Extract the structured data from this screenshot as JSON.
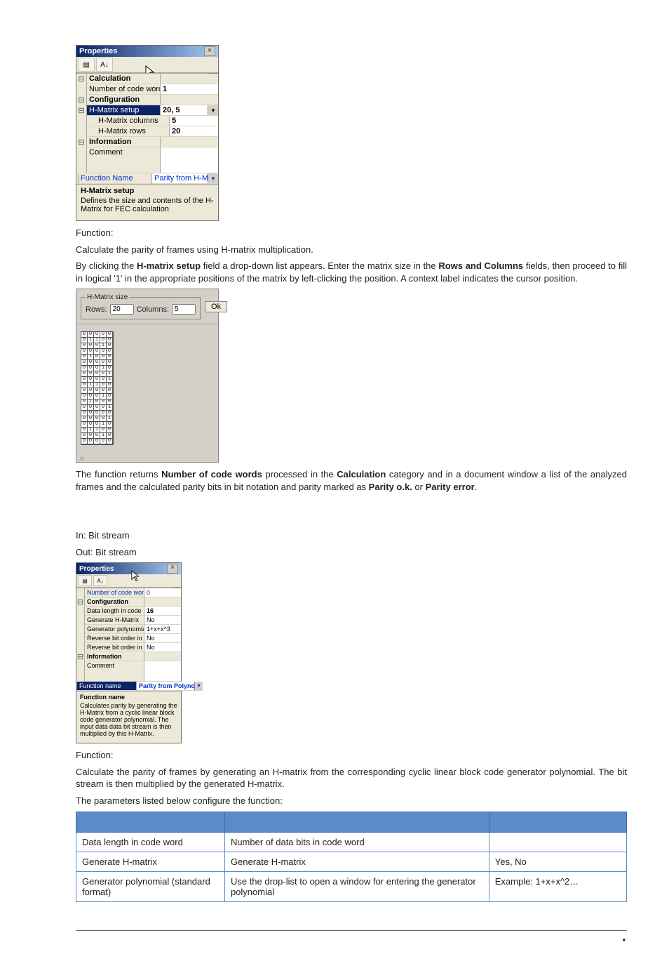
{
  "props1": {
    "title": "Properties",
    "toolbar": {
      "b1": "▤",
      "b2": "A↓"
    },
    "cat_calc": "Calculation",
    "ncw_label": "Number of code words",
    "ncw_val": "1",
    "cat_config": "Configuration",
    "hms_label": "H-Matrix setup",
    "hms_val": "20, 5",
    "hcols_label": "H-Matrix columns",
    "hcols_val": "5",
    "hrows_label": "H-Matrix rows",
    "hrows_val": "20",
    "cat_info": "Information",
    "comment_label": "Comment",
    "fn_label": "Function Name",
    "fn_val": "Parity from H-M…",
    "desc_title": "H-Matrix setup",
    "desc_body": "Defines the size and contents of the H-Matrix for FEC calculation"
  },
  "body": {
    "function_heading": "Function:",
    "p1": "Calculate the parity of frames using H-matrix multiplication.",
    "p2_a": "By clicking the ",
    "p2_b": "H-matrix setup",
    "p2_c": " field a drop-down list appears. Enter the matrix size in the ",
    "p2_d": "Rows and Columns",
    "p2_e": " fields, then proceed to fill in logical '1' in the appropriate positions of the matrix by left-clicking the position. A context label indicates the cursor position.",
    "p3_a": "The function returns ",
    "p3_b": "Number of code words",
    "p3_c": " processed in the ",
    "p3_d": "Calculation",
    "p3_e": " category and in a document window a list of the analyzed frames and the calculated parity bits in bit notation and parity marked as ",
    "p3_f": "Parity o.k.",
    "p3_g": " or ",
    "p3_h": "Parity error",
    "p3_i": ".",
    "in": "In: Bit stream",
    "out": "Out: Bit stream",
    "function_heading2": "Function:",
    "p4": "Calculate the parity of frames by generating an H-matrix from the corresponding cyclic linear block code generator polynomial. The bit stream is then multiplied by the generated H-matrix.",
    "p5": "The parameters listed below configure the function:"
  },
  "matrix_dialog": {
    "legend": "H-Matrix size",
    "rows_label": "Rows:",
    "rows_val": "20",
    "cols_label": "Columns:",
    "cols_val": "5",
    "ok": "Ok"
  },
  "matrix_data": {
    "rows": 20,
    "cols": 5,
    "cells": [
      "00000",
      "01100",
      "00010",
      "00000",
      "01000",
      "00000",
      "00010",
      "00001",
      "00001",
      "01100",
      "00000",
      "00010",
      "01000",
      "00001",
      "00000",
      "00001",
      "00010",
      "01100",
      "00010",
      "00000"
    ]
  },
  "props2": {
    "title": "Properties",
    "ncw_label": "Number of code word…",
    "ncw_val": "0",
    "cat_config": "Configuration",
    "dlen_label": "Data length in code …",
    "dlen_val": "16",
    "gen_label": "Generate H-Matrix",
    "gen_val": "No",
    "poly_label": "Generator polynomial …",
    "poly_val": "1+x+x^3",
    "rev1_label": "Reverse bit order in …",
    "rev1_val": "No",
    "rev2_label": "Reverse bit order in …",
    "rev2_val": "No",
    "cat_info": "Information",
    "comment_label": "Comment",
    "fn_label": "Function name",
    "fn_val": "Parity from Polynom",
    "desc_title": "Function name",
    "desc_body": "Calculates parity by generating the H-Matrix from a cyclic linear block code generator polynomial. The input data data bit stream is then multiplied by this H-Matrix."
  },
  "table": {
    "r1c1": "Data length in code word",
    "r1c2": "Number of data bits in code word",
    "r1c3": "",
    "r2c1": "Generate H-matrix",
    "r2c2": "Generate H-matrix",
    "r2c3": "Yes, No",
    "r3c1": "Generator polynomial (standard format)",
    "r3c2": "Use the drop-list to open a window for entering the generator polynomial",
    "r3c3": "Example: 1+x+x^2…"
  },
  "footer": {
    "bullet": "•"
  }
}
